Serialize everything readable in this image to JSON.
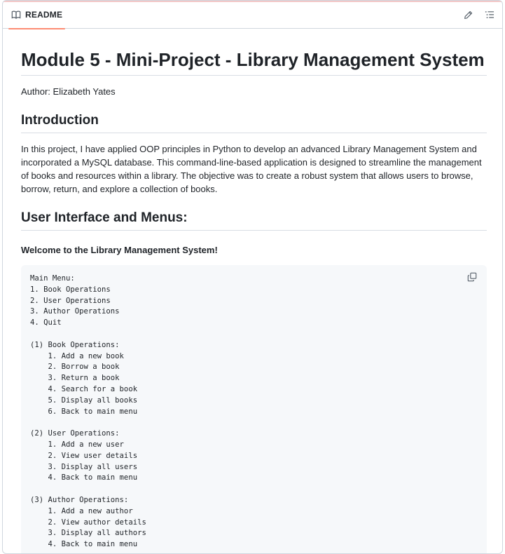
{
  "tab": {
    "label": "README",
    "accent": "#fd8c73"
  },
  "readme": {
    "title": "Module 5 - Mini-Project - Library Management System",
    "author": "Author: Elizabeth Yates",
    "intro_heading": "Introduction",
    "intro_text": "In this project, I have applied OOP principles in Python to develop an advanced Library Management System and incorporated a MySQL database. This command-line-based application is designed to streamline the management of books and resources within a library. The objective was to create a robust system that allows users to browse, borrow, return, and explore a collection of books.",
    "ui_heading": "User Interface and Menus:",
    "welcome": "Welcome to the Library Management System!",
    "code": "Main Menu:\n1. Book Operations\n2. User Operations\n3. Author Operations\n4. Quit\n\n(1) Book Operations:\n    1. Add a new book\n    2. Borrow a book\n    3. Return a book\n    4. Search for a book\n    5. Display all books\n    6. Back to main menu\n\n(2) User Operations:\n    1. Add a new user\n    2. View user details\n    3. Display all users\n    4. Back to main menu\n\n(3) Author Operations:\n    1. Add a new author\n    2. View author details\n    3. Display all authors\n    4. Back to main menu"
  },
  "icons": {
    "tab": "book-open-icon",
    "edit": "pencil-icon",
    "outline": "list-icon",
    "copy": "copy-icon"
  }
}
